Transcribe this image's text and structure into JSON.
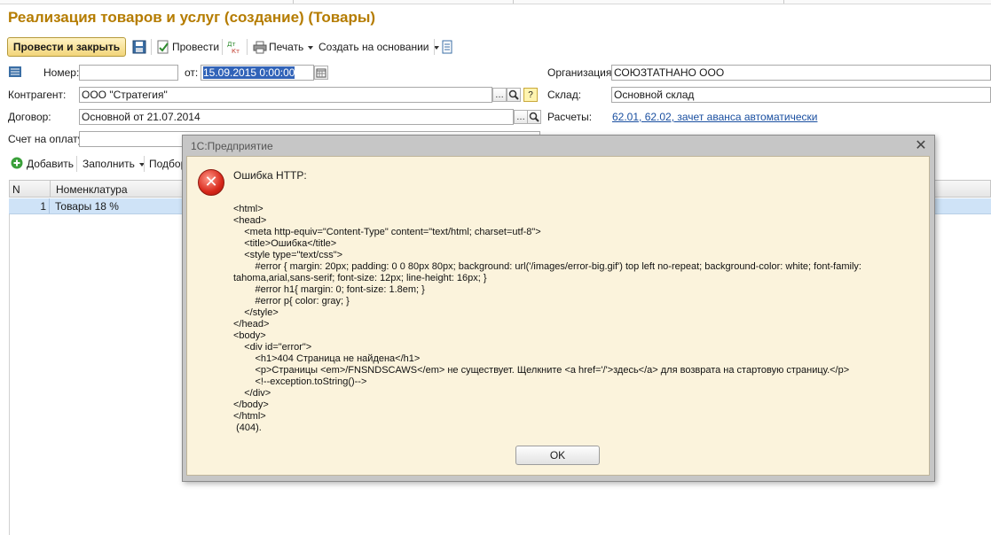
{
  "window": {
    "title": "Реализация товаров и услуг (создание) (Товары)"
  },
  "toolbar": {
    "post_close": "Провести и закрыть",
    "post": "Провести",
    "print": "Печать",
    "create_based": "Создать на основании"
  },
  "form": {
    "number_label": "Номер:",
    "number_value": "",
    "date_label": "от:",
    "date_value": "15.09.2015  0:00:00",
    "org_label": "Организация:",
    "org_value": "СОЮЗТАТНАНО ООО",
    "contractor_label": "Контрагент:",
    "contractor_value": "ООО \"Стратегия\"",
    "warehouse_label": "Склад:",
    "warehouse_value": "Основной склад",
    "contract_label": "Договор:",
    "contract_value": "Основной от 21.07.2014",
    "settlements_label": "Расчеты:",
    "settlements_value": "62.01, 62.02, зачет аванса автоматически",
    "invoice_label": "Счет на оплату:",
    "invoice_value": ""
  },
  "table_toolbar": {
    "add": "Добавить",
    "fill": "Заполнить",
    "select": "Подбор"
  },
  "table": {
    "columns": [
      "N",
      "Номенклатура"
    ],
    "rows": [
      {
        "n": "1",
        "item": "Товары 18 %"
      }
    ]
  },
  "dialog": {
    "title": "1С:Предприятие",
    "message_title": "Ошибка HTTP:",
    "message_body": "<html>\n<head>\n    <meta http-equiv=\"Content-Type\" content=\"text/html; charset=utf-8\">\n    <title>Ошибка</title>\n    <style type=\"text/css\">\n        #error { margin: 20px; padding: 0 0 80px 80px; background: url('/images/error-big.gif') top left no-repeat; background-color: white; font-family: tahoma,arial,sans-serif; font-size: 12px; line-height: 16px; }\n        #error h1{ margin: 0; font-size: 1.8em; }\n        #error p{ color: gray; }\n    </style>\n</head>\n<body>\n    <div id=\"error\">\n        <h1>404 Страница не найдена</h1>\n        <p>Страницы <em>/FNSNDSCAWS</em> не существует. Щелкните <a href='/'>здесь</a> для возврата на стартовую страницу.</p>\n        <!--exception.toString()-->\n    </div>\n</body>\n</html>\n (404).",
    "ok": "OK"
  },
  "colors": {
    "title": "#b57c00",
    "link": "#1a4fa0",
    "selected_row": "#cfe3f7",
    "dialog_body": "#fbf3dc",
    "error_icon": "#d8281b"
  }
}
